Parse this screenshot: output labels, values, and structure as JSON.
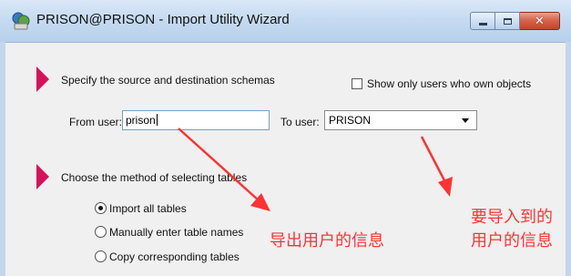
{
  "window": {
    "title": "PRISON@PRISON - Import Utility Wizard"
  },
  "step1": {
    "heading": "Specify the source and destination schemas",
    "show_only_owners_label": "Show only users who own objects",
    "show_only_owners_checked": false,
    "from_user_label": "From user:",
    "from_user_value": "prison",
    "to_user_label": "To user:",
    "to_user_value": "PRISON"
  },
  "step2": {
    "heading": "Choose the method of selecting tables",
    "options": [
      {
        "label": "Import all tables",
        "selected": true
      },
      {
        "label": "Manually enter table names",
        "selected": false
      },
      {
        "label": "Copy corresponding tables",
        "selected": false
      }
    ]
  },
  "annotations": {
    "export_user_note": "导出用户的信息",
    "import_target_note_line1": "要导入到的",
    "import_target_note_line2": "用户的信息"
  },
  "colors": {
    "step_marker": "#d6135a",
    "annotation": "#ff3333",
    "titlebar": "#c6dbf1"
  }
}
